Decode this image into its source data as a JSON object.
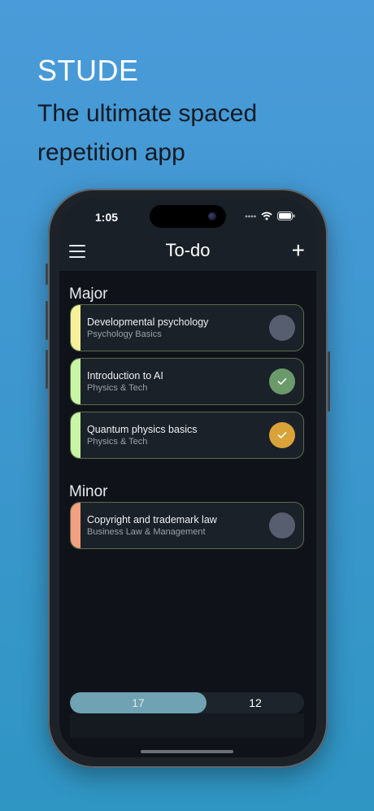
{
  "promo": {
    "title": "STUDE",
    "subtitle": "The ultimate spaced repetition app"
  },
  "status_bar": {
    "time": "1:05",
    "icons": [
      "signal-dots-icon",
      "wifi-icon",
      "battery-icon"
    ]
  },
  "nav": {
    "title": "To-do",
    "menu_icon": "hamburger-menu-icon",
    "add_icon": "plus-icon"
  },
  "sections": [
    {
      "title": "Major",
      "items": [
        {
          "title": "Developmental psychology",
          "subtitle": "Psychology Basics",
          "bar_color": "#f4f19a",
          "status": "pending",
          "status_color": "#565e70"
        },
        {
          "title": "Introduction to AI",
          "subtitle": "Physics & Tech",
          "bar_color": "#c8f5a4",
          "status": "done",
          "status_color": "#6b9a6a"
        },
        {
          "title": "Quantum physics basics",
          "subtitle": "Physics & Tech",
          "bar_color": "#c8f5a4",
          "status": "done",
          "status_color": "#d9a33a"
        }
      ]
    },
    {
      "title": "Minor",
      "items": [
        {
          "title": "Copyright and trademark law",
          "subtitle": "Business Law & Management",
          "bar_color": "#f2a07f",
          "status": "pending",
          "status_color": "#565e70"
        }
      ]
    }
  ],
  "bottom_tabs": [
    {
      "label": "17",
      "active": true
    },
    {
      "label": "12",
      "active": false
    }
  ]
}
